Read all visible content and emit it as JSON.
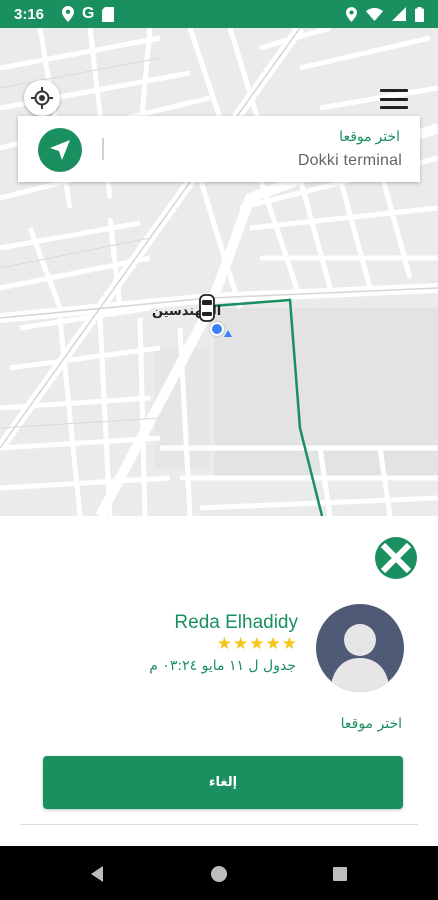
{
  "status_bar": {
    "time": "3:16",
    "left_icons": [
      "location-icon",
      "google-icon",
      "sd-card-icon"
    ],
    "right_icons": [
      "location-icon",
      "wifi-icon",
      "signal-icon",
      "battery-icon"
    ],
    "google_glyph": "G"
  },
  "map": {
    "area_label": "المهندسين",
    "route_color": "#1a9060"
  },
  "search_card": {
    "label": "اختر موقعا",
    "value": "Dokki terminal"
  },
  "driver": {
    "name": "Reda Elhadidy",
    "stars": "★★★★★",
    "rating": 5,
    "schedule": "جدول ل ١١ مايو ٠٣:٢٤ م"
  },
  "sheet": {
    "pick_label": "اختر موقعا",
    "cancel_label": "إلغاء"
  },
  "colors": {
    "brand": "#1a9060",
    "star": "#f5c518",
    "avatar_bg": "#4f5a76"
  }
}
